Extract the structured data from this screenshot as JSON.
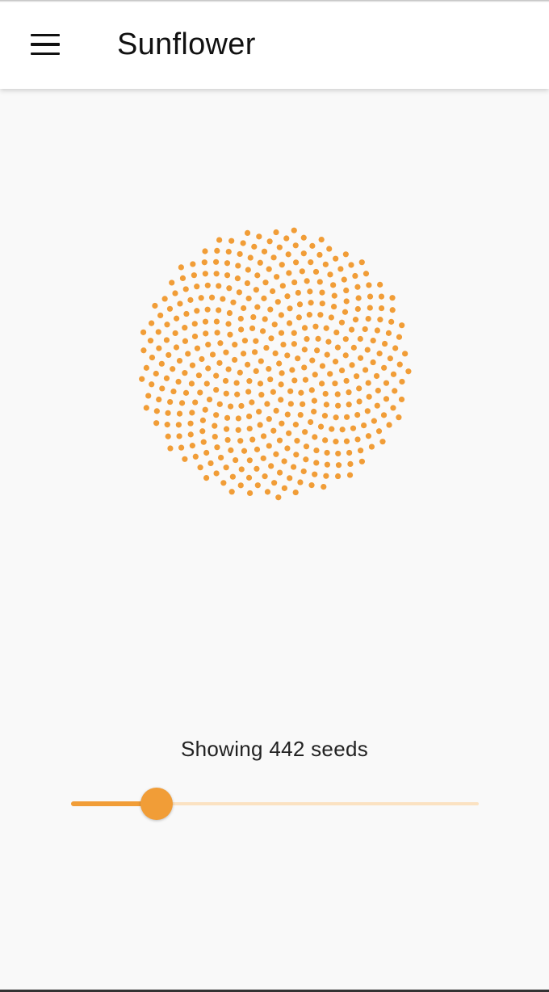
{
  "app_bar": {
    "title": "Sunflower",
    "menu_icon": "hamburger-menu-icon"
  },
  "sunflower": {
    "seed_count": 442,
    "seed_color": "#f19d37"
  },
  "status": {
    "text": "Showing 442 seeds"
  },
  "slider": {
    "value_fraction": 0.21,
    "active_color": "#f19d37",
    "inactive_color": "#fbe2c2"
  }
}
